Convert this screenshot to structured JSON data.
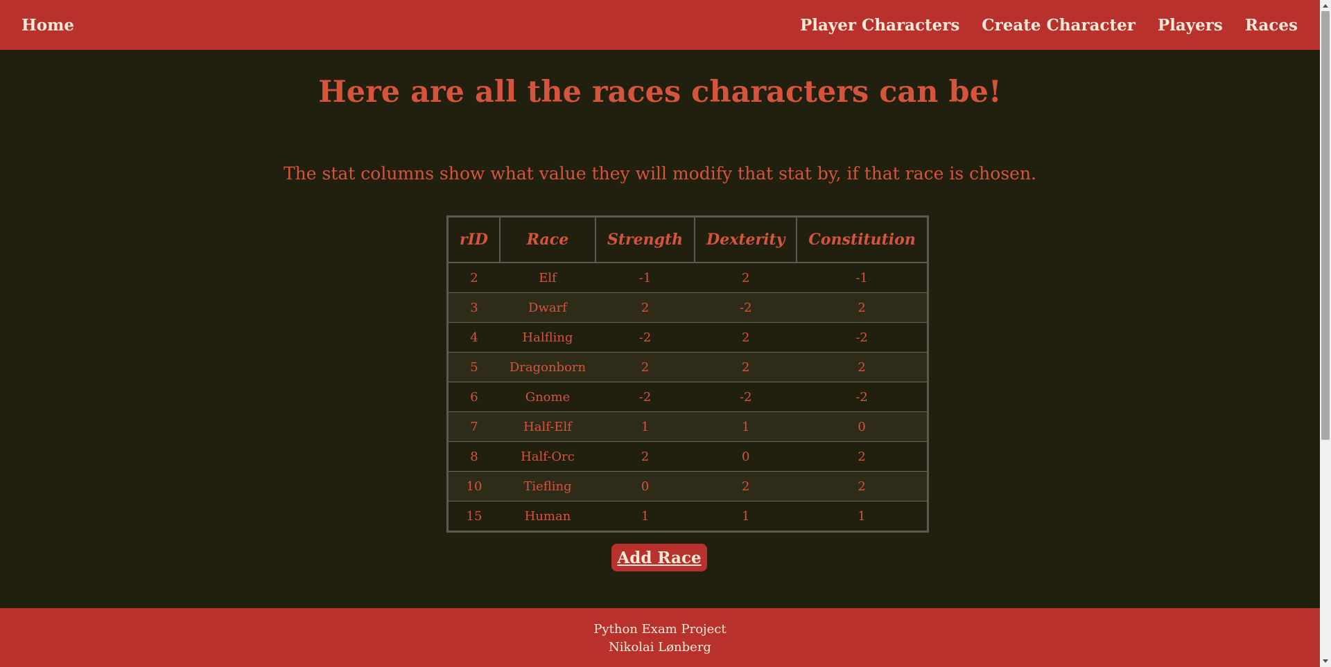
{
  "nav": {
    "home": "Home",
    "links": [
      "Player Characters",
      "Create Character",
      "Players",
      "Races"
    ]
  },
  "main": {
    "title": "Here are all the races characters can be!",
    "subtitle": "The stat columns show what value they will modify that stat by, if that race is chosen.",
    "add_button": "Add Race"
  },
  "table": {
    "headers": [
      "rID",
      "Race",
      "Strength",
      "Dexterity",
      "Constitution"
    ],
    "rows": [
      [
        "2",
        "Elf",
        "-1",
        "2",
        "-1"
      ],
      [
        "3",
        "Dwarf",
        "2",
        "-2",
        "2"
      ],
      [
        "4",
        "Halfling",
        "-2",
        "2",
        "-2"
      ],
      [
        "5",
        "Dragonborn",
        "2",
        "2",
        "2"
      ],
      [
        "6",
        "Gnome",
        "-2",
        "-2",
        "-2"
      ],
      [
        "7",
        "Half-Elf",
        "1",
        "1",
        "0"
      ],
      [
        "8",
        "Half-Orc",
        "2",
        "0",
        "2"
      ],
      [
        "10",
        "Tiefling",
        "0",
        "2",
        "2"
      ],
      [
        "15",
        "Human",
        "1",
        "1",
        "1"
      ]
    ]
  },
  "footer": {
    "line1": "Python Exam Project",
    "line2": "Nikolai Lønberg"
  },
  "colors": {
    "brand": "#b8312d",
    "background": "#211f0e",
    "accent_text": "#d4543e",
    "light_text": "#f5ead8"
  }
}
